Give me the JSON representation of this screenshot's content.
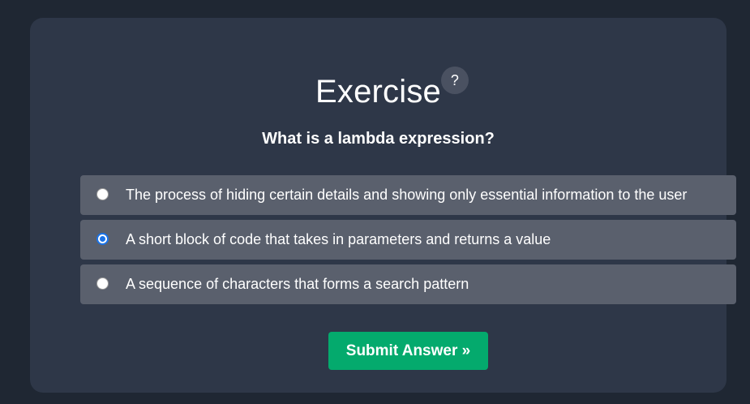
{
  "exercise": {
    "title": "Exercise",
    "help_label": "?",
    "question": "What is a lambda expression?",
    "options": [
      {
        "label": "The process of hiding certain details and showing only essential information to the user",
        "selected": false
      },
      {
        "label": "A short block of code that takes in parameters and returns a value",
        "selected": true
      },
      {
        "label": "A sequence of characters that forms a search pattern",
        "selected": false
      }
    ],
    "submit_label": "Submit Answer »"
  },
  "colors": {
    "page_background": "#1f2733",
    "card_background": "#2e3748",
    "option_background": "#5a606d",
    "help_background": "#4a5161",
    "submit_background": "#04aa6d",
    "radio_selected": "#1a73e8",
    "text": "#ffffff"
  }
}
